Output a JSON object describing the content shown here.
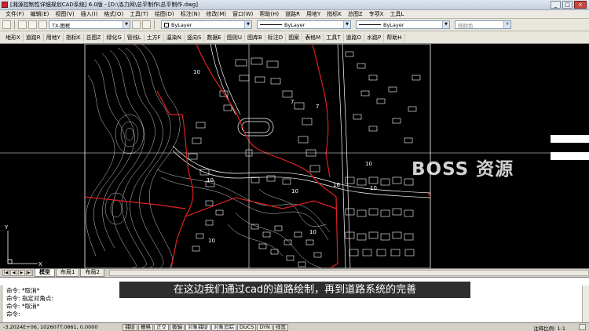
{
  "window": {
    "title": "[湘源控制性详细规划CAD系统] 6.0版 - [D:\\洛力网\\总平制作\\总平制作.dwg]",
    "controls": [
      "_",
      "□",
      "×"
    ]
  },
  "menu": [
    "文件(F)",
    "编辑(E)",
    "视图(V)",
    "插入(I)",
    "格式(O)",
    "工具(T)",
    "绘图(D)",
    "标注(N)",
    "修改(M)",
    "窗口(W)",
    "帮助(H)",
    "道路R",
    "用地Y",
    "指标K",
    "总图Z",
    "专项X",
    "工具L"
  ],
  "toolbar": {
    "layer_value": "TX-图框",
    "color_value": "ByLayer",
    "linetype_value": "ByLayer",
    "lineweight_value": "ByLayer",
    "plotstyle_value": "随颜色"
  },
  "toolbar2": [
    "地形X",
    "道路R",
    "用地Y",
    "指标K",
    "总图Z",
    "绿化G",
    "管线L",
    "土方F",
    "温染N",
    "竖向S",
    "数据E",
    "图则U",
    "图库B",
    "标注D",
    "图案",
    "表格M",
    "工具T",
    "道路O",
    "水路P",
    "帮助H"
  ],
  "canvas": {
    "labels": [
      "10",
      "7",
      "7",
      "10",
      "10",
      "16",
      "10",
      "10",
      "10",
      "10"
    ],
    "ucs_x": "X",
    "ucs_y": "Y"
  },
  "layout_tabs": [
    "模型",
    "布局1",
    "布局2"
  ],
  "command": {
    "lines": [
      "命令: *取消*",
      "命令: 指定对角点:",
      "命令: *取消*",
      "命令:"
    ]
  },
  "subtitle": "在这边我们通过cad的道路绘制，再到道路系统的完善",
  "watermark": "BOSS 资源",
  "status": {
    "coords": "-3.2024E+06, 102607T.0861, 0.0000",
    "toggles": [
      "捕捉",
      "栅格",
      "正交",
      "极轴",
      "对象捕捉",
      "对象追踪",
      "DUCS",
      "DYN",
      "线宽"
    ],
    "toggles_on": [
      false,
      false,
      true,
      false,
      true,
      true,
      false,
      false,
      false
    ],
    "scale": "注释比例: 1:1"
  },
  "colors": {
    "canvas_bg": "#000000",
    "road_red": "#e02020",
    "linework": "#ffffff"
  }
}
